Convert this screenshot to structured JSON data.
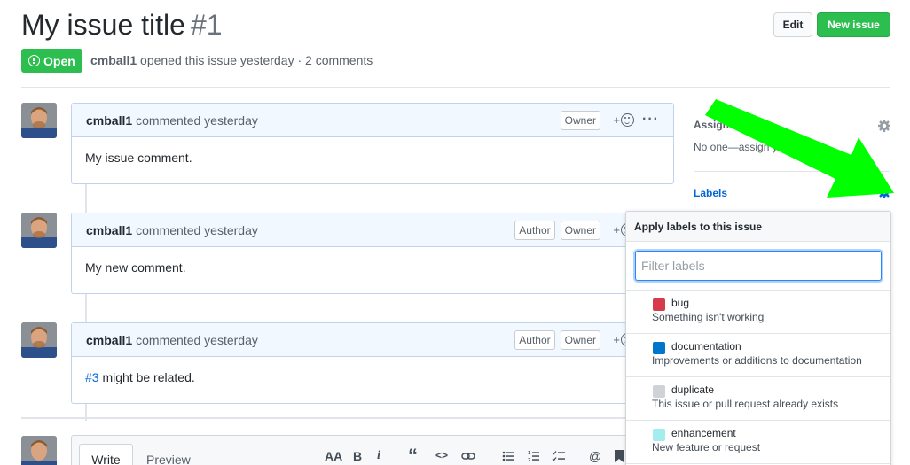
{
  "issue": {
    "title": "My issue title",
    "number": "#1",
    "state": "Open",
    "author": "cmball1",
    "meta_text": "opened this issue yesterday · 2 comments"
  },
  "header": {
    "edit_label": "Edit",
    "new_issue_label": "New issue"
  },
  "comments": [
    {
      "author": "cmball1",
      "action": "commented yesterday",
      "badges": [
        "Owner"
      ],
      "body": "My issue comment."
    },
    {
      "author": "cmball1",
      "action": "commented yesterday",
      "badges": [
        "Author",
        "Owner"
      ],
      "body": "My new comment."
    },
    {
      "author": "cmball1",
      "action": "commented yesterday",
      "badges": [
        "Author",
        "Owner"
      ],
      "body_link": "#3",
      "body_rest": " might be related."
    }
  ],
  "reaction_plus": "+",
  "more_glyph": "···",
  "sidebar": {
    "assignees_title": "Assignees",
    "assignees_value": "No one—assign yourself",
    "labels_title": "Labels"
  },
  "labels_popup": {
    "header": "Apply labels to this issue",
    "filter_placeholder": "Filter labels",
    "items": [
      {
        "name": "bug",
        "description": "Something isn't working",
        "color": "#d73a4a"
      },
      {
        "name": "documentation",
        "description": "Improvements or additions to documentation",
        "color": "#0075ca"
      },
      {
        "name": "duplicate",
        "description": "This issue or pull request already exists",
        "color": "#cfd3d7"
      },
      {
        "name": "enhancement",
        "description": "New feature or request",
        "color": "#a2eeef"
      }
    ]
  },
  "editor": {
    "write_tab": "Write",
    "preview_tab": "Preview",
    "toolbar": [
      "AA",
      "B",
      "i",
      "“",
      "<>",
      "link",
      "ul",
      "ol",
      "task",
      "@",
      "bookmark"
    ]
  },
  "colors": {
    "accent_green": "#2cbe4e",
    "link_blue": "#0366d6",
    "arrow_green": "#00ff00"
  }
}
